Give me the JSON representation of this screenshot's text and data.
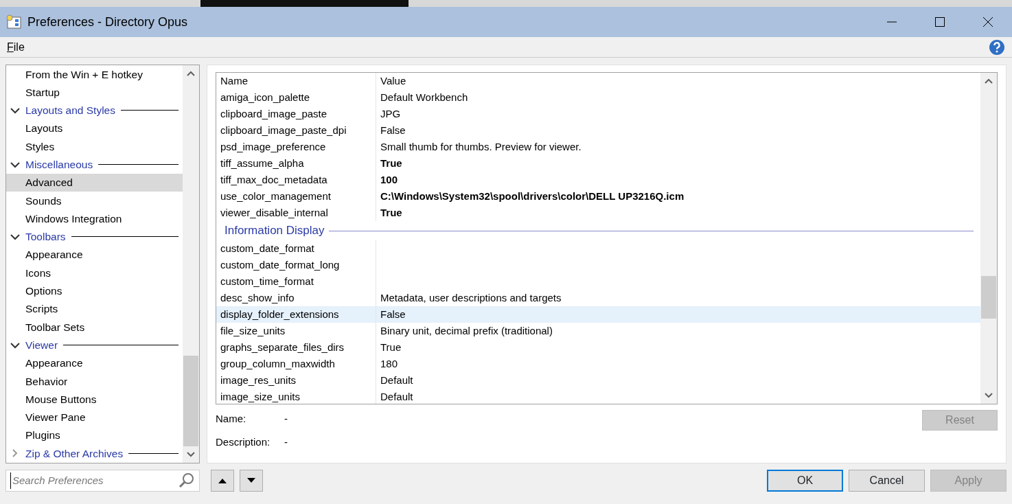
{
  "window": {
    "title": "Preferences - Directory Opus"
  },
  "menu": [
    {
      "label": "File"
    }
  ],
  "tree": [
    {
      "label": "From the Win + E hotkey",
      "kind": "page",
      "selected": false
    },
    {
      "label": "Startup",
      "kind": "page",
      "selected": false
    },
    {
      "label": "Layouts and Styles",
      "kind": "category",
      "expanded": true,
      "children": [
        {
          "label": "Layouts",
          "kind": "page",
          "selected": false
        },
        {
          "label": "Styles",
          "kind": "page",
          "selected": false
        }
      ]
    },
    {
      "label": "Miscellaneous",
      "kind": "category",
      "expanded": true,
      "children": [
        {
          "label": "Advanced",
          "kind": "page",
          "selected": true
        },
        {
          "label": "Sounds",
          "kind": "page",
          "selected": false
        },
        {
          "label": "Windows Integration",
          "kind": "page",
          "selected": false
        }
      ]
    },
    {
      "label": "Toolbars",
      "kind": "category",
      "expanded": true,
      "children": [
        {
          "label": "Appearance",
          "kind": "page",
          "selected": false
        },
        {
          "label": "Icons",
          "kind": "page",
          "selected": false
        },
        {
          "label": "Options",
          "kind": "page",
          "selected": false
        },
        {
          "label": "Scripts",
          "kind": "page",
          "selected": false
        },
        {
          "label": "Toolbar Sets",
          "kind": "page",
          "selected": false
        }
      ]
    },
    {
      "label": "Viewer",
      "kind": "category",
      "expanded": true,
      "children": [
        {
          "label": "Appearance",
          "kind": "page",
          "selected": false
        },
        {
          "label": "Behavior",
          "kind": "page",
          "selected": false
        },
        {
          "label": "Mouse Buttons",
          "kind": "page",
          "selected": false
        },
        {
          "label": "Viewer Pane",
          "kind": "page",
          "selected": false
        },
        {
          "label": "Plugins",
          "kind": "page",
          "selected": false
        }
      ]
    },
    {
      "label": "Zip & Other Archives",
      "kind": "category",
      "expanded": false
    }
  ],
  "search": {
    "placeholder": "Search Preferences"
  },
  "table": {
    "columns": [
      "Name",
      "Value"
    ],
    "rows": [
      {
        "kind": "setting",
        "name": "amiga_icon_palette",
        "value": "Default Workbench",
        "modified": false,
        "selected": false
      },
      {
        "kind": "setting",
        "name": "clipboard_image_paste",
        "value": "JPG",
        "modified": false,
        "selected": false
      },
      {
        "kind": "setting",
        "name": "clipboard_image_paste_dpi",
        "value": "False",
        "modified": false,
        "selected": false
      },
      {
        "kind": "setting",
        "name": "psd_image_preference",
        "value": "Small thumb for thumbs. Preview for viewer.",
        "modified": false,
        "selected": false
      },
      {
        "kind": "setting",
        "name": "tiff_assume_alpha",
        "value": "True",
        "modified": true,
        "selected": false
      },
      {
        "kind": "setting",
        "name": "tiff_max_doc_metadata",
        "value": "100",
        "modified": true,
        "selected": false
      },
      {
        "kind": "setting",
        "name": "use_color_management",
        "value": "C:\\Windows\\System32\\spool\\drivers\\color\\DELL UP3216Q.icm",
        "modified": true,
        "selected": false
      },
      {
        "kind": "setting",
        "name": "viewer_disable_internal",
        "value": "True",
        "modified": true,
        "selected": false
      },
      {
        "kind": "group",
        "name": "Information Display"
      },
      {
        "kind": "setting",
        "name": "custom_date_format",
        "selected": false
      },
      {
        "kind": "setting",
        "name": "custom_date_format_long",
        "selected": false
      },
      {
        "kind": "setting",
        "name": "custom_time_format",
        "selected": false
      },
      {
        "kind": "setting",
        "name": "desc_show_info",
        "value": "Metadata, user descriptions and targets",
        "modified": false,
        "selected": false
      },
      {
        "kind": "setting",
        "name": "display_folder_extensions",
        "value": "False",
        "modified": false,
        "selected": true
      },
      {
        "kind": "setting",
        "name": "file_size_units",
        "value": "Binary unit, decimal prefix (traditional)",
        "modified": false,
        "selected": false
      },
      {
        "kind": "setting",
        "name": "graphs_separate_files_dirs",
        "value": "True",
        "modified": false,
        "selected": false
      },
      {
        "kind": "setting",
        "name": "group_column_maxwidth",
        "value": "180",
        "modified": false,
        "selected": false
      },
      {
        "kind": "setting",
        "name": "image_res_units",
        "value": "Default",
        "modified": false,
        "selected": false
      },
      {
        "kind": "setting",
        "name": "image_size_units",
        "value": "Default",
        "modified": false,
        "selected": false
      }
    ]
  },
  "details": [
    {
      "label": "Name:",
      "value": "-"
    },
    {
      "label": "Description:",
      "value": "-"
    }
  ],
  "reset_button": {
    "label": "Reset",
    "disabled": true
  },
  "buttons": [
    {
      "label": "OK",
      "default": true,
      "disabled": false
    },
    {
      "label": "Cancel",
      "default": false,
      "disabled": false
    },
    {
      "label": "Apply",
      "default": false,
      "disabled": true
    }
  ]
}
